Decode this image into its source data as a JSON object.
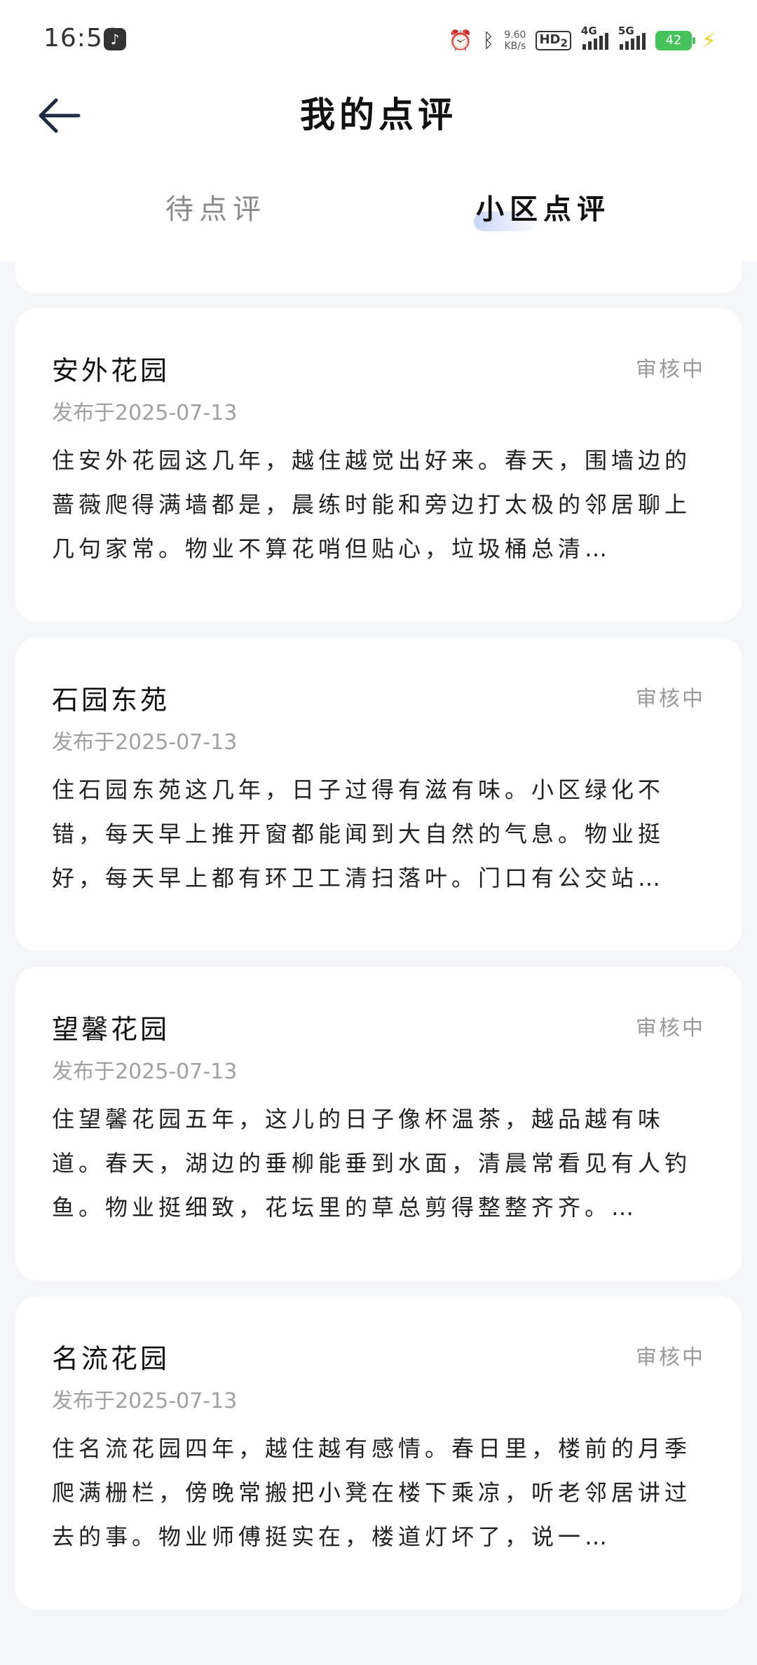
{
  "status_bar": {
    "time": "16:56",
    "net_speed_value": "9.60",
    "net_speed_unit": "KB/s",
    "hd_label": "HD",
    "hd_sub": "2",
    "sim1_label": "4G",
    "sim2_label": "5G",
    "battery_level": "42"
  },
  "header": {
    "title": "我的点评",
    "back_icon": "arrow-left-icon"
  },
  "tabs": [
    {
      "label": "待点评",
      "selected": false
    },
    {
      "label": "小区点评",
      "selected": true
    }
  ],
  "reviews": [
    {
      "name": "安外花园",
      "status": "审核中",
      "date": "发布于2025-07-13",
      "text": "住安外花园这几年，越住越觉出好来。春天，围墙边的蔷薇爬得满墙都是，晨练时能和旁边打太极的邻居聊上几句家常。物业不算花哨但贴心，垃圾桶总清…"
    },
    {
      "name": "石园东苑",
      "status": "审核中",
      "date": "发布于2025-07-13",
      "text": "住石园东苑这几年，日子过得有滋有味。小区绿化不错，每天早上推开窗都能闻到大自然的气息。物业挺好，每天早上都有环卫工清扫落叶。门口有公交站…"
    },
    {
      "name": "望馨花园",
      "status": "审核中",
      "date": "发布于2025-07-13",
      "text": "住望馨花园五年，这儿的日子像杯温茶，越品越有味道。春天，湖边的垂柳能垂到水面，清晨常看见有人钓鱼。物业挺细致，花坛里的草总剪得整整齐齐。…"
    },
    {
      "name": "名流花园",
      "status": "审核中",
      "date": "发布于2025-07-13",
      "text": "住名流花园四年，越住越有感情。春日里，楼前的月季爬满栅栏，傍晚常搬把小凳在楼下乘凉，听老邻居讲过去的事。物业师傅挺实在，楼道灯坏了，说一…"
    }
  ]
}
